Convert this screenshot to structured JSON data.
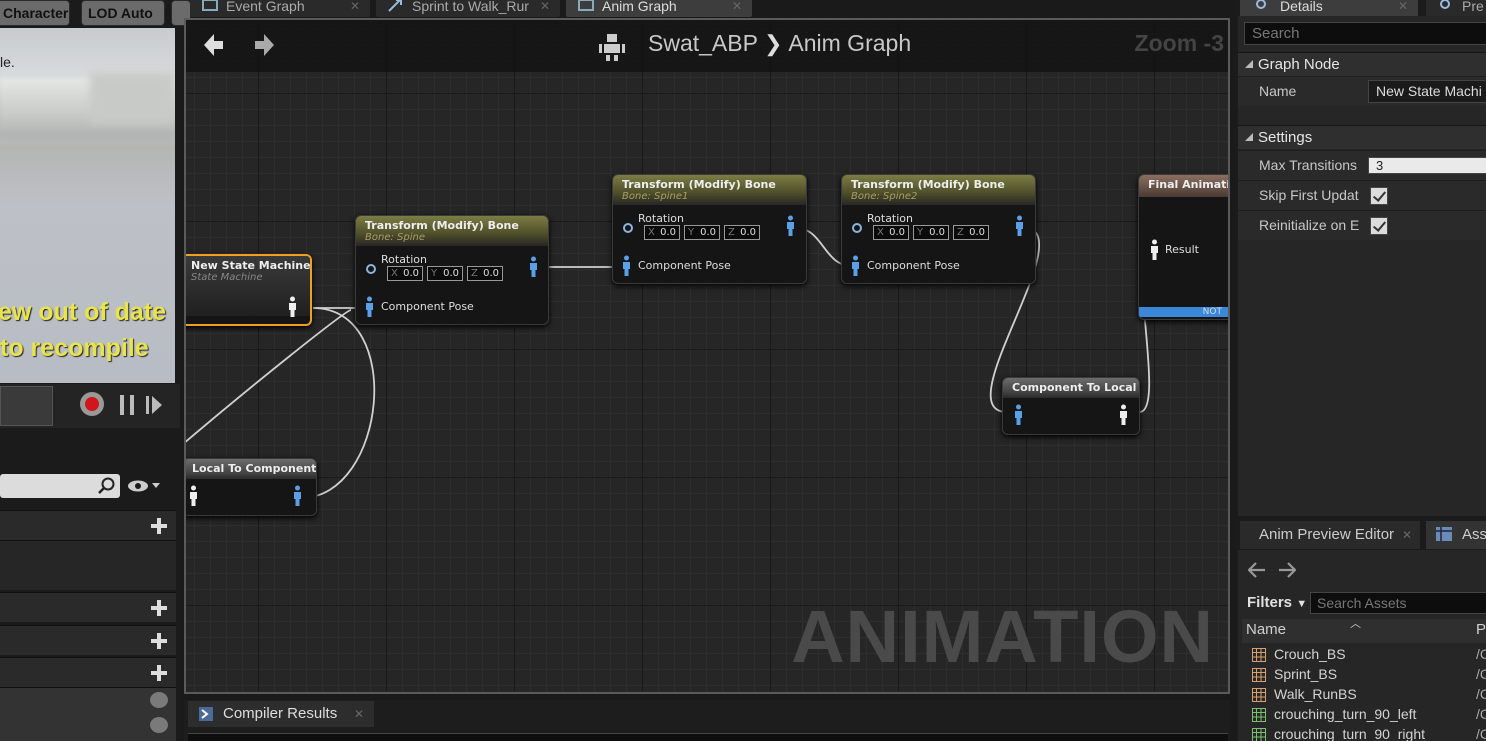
{
  "toolbar": {
    "character_label": "Character",
    "lod_label": "LOD Auto"
  },
  "viewport": {
    "text_top_small": "le.",
    "warning_line1": "ew out of date",
    "warning_line2": "to recompile"
  },
  "tabs": [
    {
      "label": "Event Graph",
      "icon": "event-graph-icon"
    },
    {
      "label": "Sprint to Walk_Rur",
      "icon": "transition-icon"
    },
    {
      "label": "Anim Graph",
      "icon": "anim-graph-icon",
      "active": true
    }
  ],
  "graph": {
    "breadcrumb_root": "Swat_ABP",
    "breadcrumb_leaf": "Anim Graph",
    "zoom": "Zoom -3",
    "watermark": "ANIMATION"
  },
  "nodes": {
    "state_machine": {
      "title": "New State Machine",
      "subtitle": "State Machine"
    },
    "tmb1": {
      "title": "Transform (Modify) Bone",
      "subtitle": "Bone: Spine",
      "rot_label": "Rotation",
      "x": "0.0",
      "y": "0.0",
      "z": "0.0",
      "pose_label": "Component Pose"
    },
    "tmb2": {
      "title": "Transform (Modify) Bone",
      "subtitle": "Bone: Spine1",
      "rot_label": "Rotation",
      "x": "0.0",
      "y": "0.0",
      "z": "0.0",
      "pose_label": "Component Pose"
    },
    "tmb3": {
      "title": "Transform (Modify) Bone",
      "subtitle": "Bone: Spine2",
      "rot_label": "Rotation",
      "x": "0.0",
      "y": "0.0",
      "z": "0.0",
      "pose_label": "Component Pose"
    },
    "final": {
      "title": "Final Animation",
      "result_label": "Result",
      "footer": "NOT"
    },
    "c2l": {
      "title": "Component To Local"
    },
    "l2c": {
      "title": "Local To Component"
    }
  },
  "axis_labels": {
    "x": "X",
    "y": "Y",
    "z": "Z"
  },
  "details": {
    "tab_details": "Details",
    "tab_preview": "Pre",
    "search_placeholder": "Search",
    "cat_graph_node": "Graph Node",
    "name_label": "Name",
    "name_value": "New State Machi",
    "cat_settings": "Settings",
    "max_transitions_label": "Max Transitions",
    "max_transitions_value": "3",
    "skip_first_label": "Skip First Updat",
    "reinit_label": "Reinitialize on E"
  },
  "assets": {
    "tab_preview_editor": "Anim Preview Editor",
    "tab_asset": "Asse",
    "filters_label": "Filters",
    "search_placeholder": "Search Assets",
    "col_name": "Name",
    "col_path": "P",
    "items": [
      {
        "name": "Crouch_BS",
        "path": "/C",
        "kind": "blendspace"
      },
      {
        "name": "Sprint_BS",
        "path": "/C",
        "kind": "blendspace"
      },
      {
        "name": "Walk_RunBS",
        "path": "/C",
        "kind": "blendspace"
      },
      {
        "name": "crouching_turn_90_left",
        "path": "/C",
        "kind": "sequence"
      },
      {
        "name": "crouching_turn_90_right",
        "path": "/C",
        "kind": "sequence"
      }
    ]
  },
  "compiler": {
    "tab_label": "Compiler Results"
  },
  "colors": {
    "pin_blue": "#5aa0e6",
    "node_header": "#7c7c44",
    "selected_outline": "#f0a020",
    "record_red": "#d0151c"
  }
}
